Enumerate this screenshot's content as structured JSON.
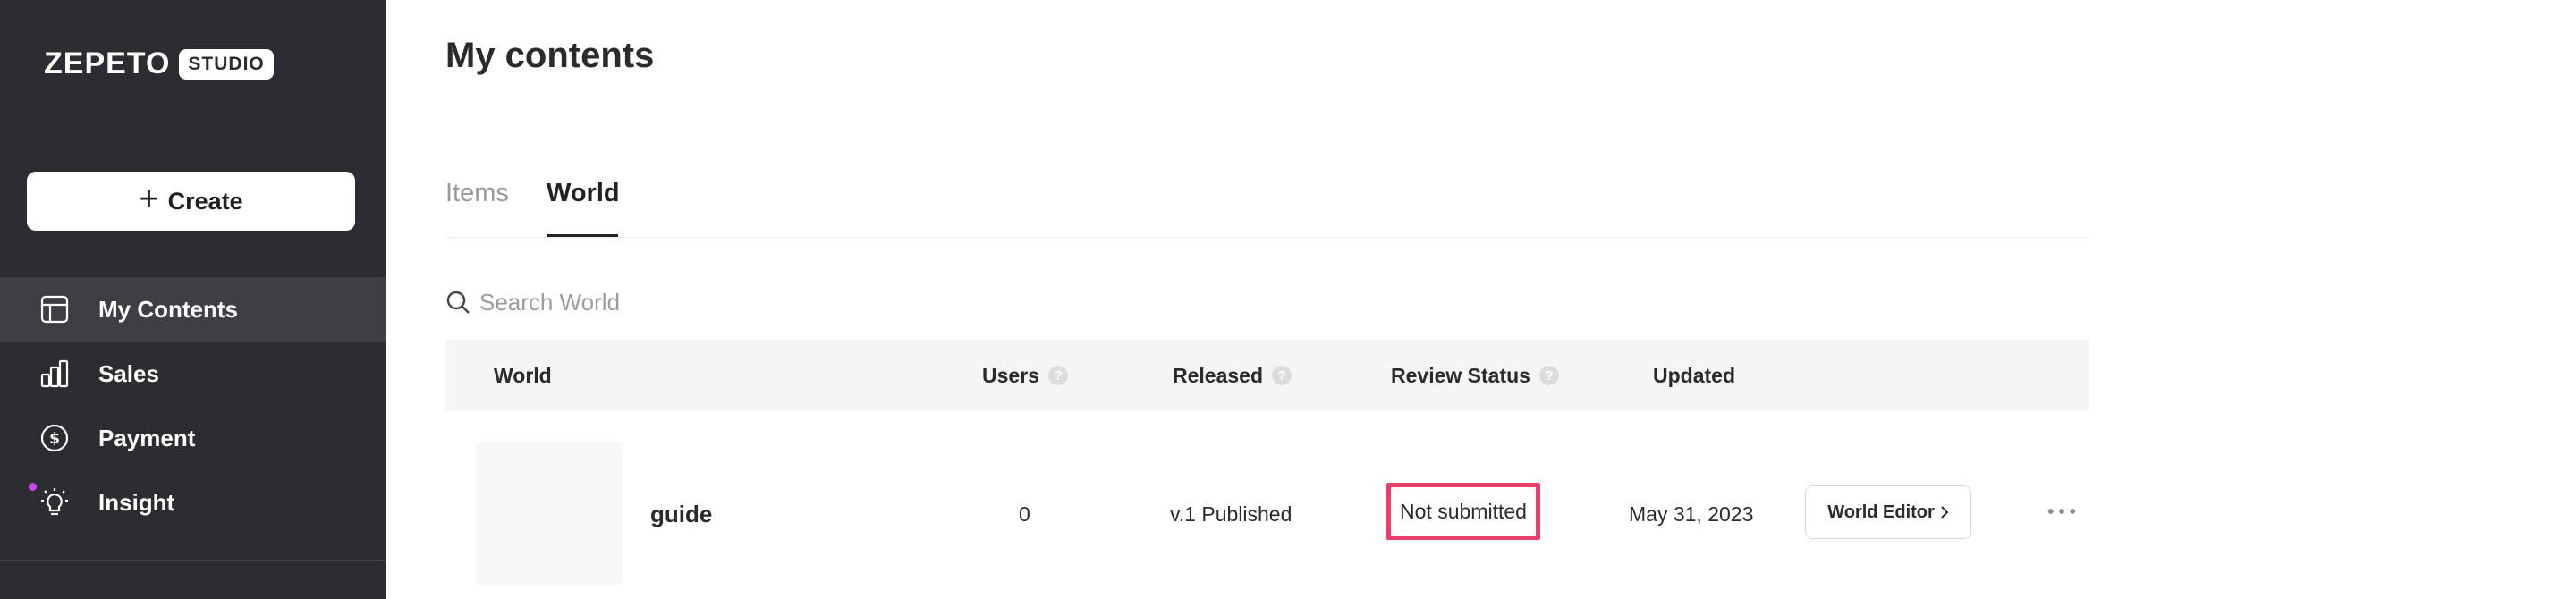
{
  "sidebar": {
    "logo": {
      "main": "ZEPETO",
      "badge": "STUDIO"
    },
    "create_label": "Create",
    "items": [
      {
        "label": "My Contents",
        "icon": "layout-icon"
      },
      {
        "label": "Sales",
        "icon": "bar-chart-icon"
      },
      {
        "label": "Payment",
        "icon": "dollar-circle-icon"
      },
      {
        "label": "Insight",
        "icon": "lightbulb-icon"
      }
    ],
    "active_item": "My Contents"
  },
  "main": {
    "title": "My contents",
    "tabs": [
      {
        "label": "Items"
      },
      {
        "label": "World"
      }
    ],
    "active_tab": "World",
    "search": {
      "placeholder": "Search World",
      "value": ""
    },
    "table": {
      "columns": {
        "world": "World",
        "users": "Users",
        "released": "Released",
        "review_status": "Review Status",
        "updated": "Updated"
      },
      "rows": [
        {
          "name": "guide",
          "users": "0",
          "released": "v.1 Published",
          "review_status": "Not submitted",
          "updated": "May 31, 2023",
          "editor_label": "World Editor"
        }
      ]
    }
  },
  "colors": {
    "sidebar_bg": "#2c2c31",
    "sidebar_active": "#3e3e44",
    "highlight_border": "#ea3f6a",
    "insight_dot": "#c54bf0"
  }
}
